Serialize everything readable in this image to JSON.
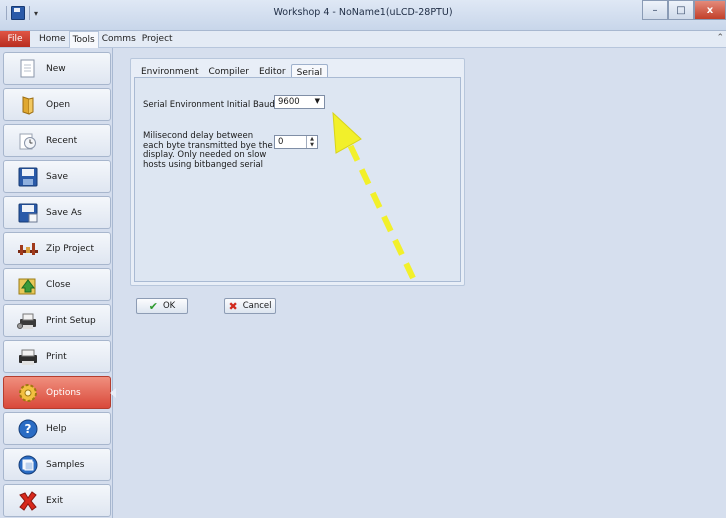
{
  "window": {
    "title": "Workshop 4 - NoName1(uLCD-28PTU)",
    "controls": {
      "minimize": "–",
      "maximize": "□",
      "close": "x"
    }
  },
  "menubar": {
    "file": "File",
    "items": [
      "Home",
      "Tools",
      "Comms",
      "Project"
    ],
    "active_index": 1
  },
  "sidebar": {
    "items": [
      {
        "label": "New",
        "icon": "new-document-icon"
      },
      {
        "label": "Open",
        "icon": "open-folder-icon"
      },
      {
        "label": "Recent",
        "icon": "recent-clock-icon"
      },
      {
        "label": "Save",
        "icon": "save-disk-icon"
      },
      {
        "label": "Save As",
        "icon": "save-as-disk-icon"
      },
      {
        "label": "Zip Project",
        "icon": "zip-clamp-icon"
      },
      {
        "label": "Close",
        "icon": "close-arrow-icon"
      },
      {
        "label": "Print Setup",
        "icon": "print-setup-icon"
      },
      {
        "label": "Print",
        "icon": "printer-icon"
      },
      {
        "label": "Options",
        "icon": "gear-icon"
      },
      {
        "label": "Help",
        "icon": "help-icon"
      },
      {
        "label": "Samples",
        "icon": "samples-icon"
      },
      {
        "label": "Exit",
        "icon": "exit-x-icon"
      }
    ],
    "active_index": 9
  },
  "options": {
    "tabs": [
      "Environment",
      "Compiler",
      "Editor",
      "Serial"
    ],
    "active_tab_index": 3,
    "baud_label": "Serial Environment Initial Baud Rate",
    "baud_value": "9600",
    "delay_label": "Milisecond delay between each byte transmitted bye the display. Only needed on slow hosts using bitbanged serial",
    "delay_value": "0",
    "ok_label": "OK",
    "cancel_label": "Cancel"
  },
  "colors": {
    "accent": "#d9493a",
    "background": "#d6dfee",
    "annotation_arrow": "#f2f02a"
  }
}
